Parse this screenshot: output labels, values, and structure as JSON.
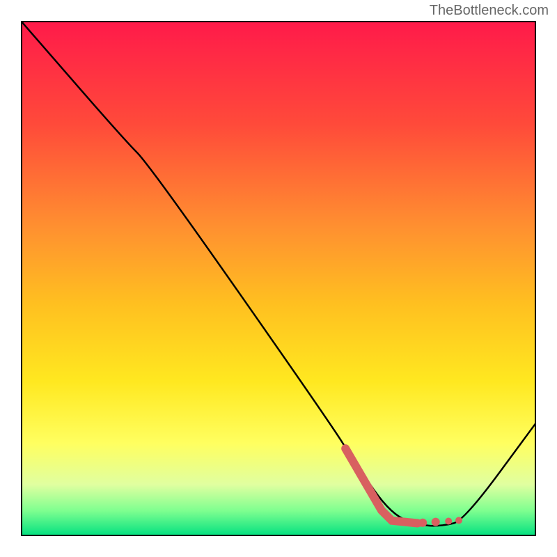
{
  "watermark": "TheBottleneck.com",
  "chart_data": {
    "type": "line",
    "title": "",
    "xlabel": "",
    "ylabel": "",
    "xlim": [
      0,
      100
    ],
    "ylim": [
      0,
      100
    ],
    "background_gradient": {
      "stops": [
        {
          "offset": 0,
          "color": "#ff1a4a"
        },
        {
          "offset": 20,
          "color": "#ff4a3a"
        },
        {
          "offset": 40,
          "color": "#ff9030"
        },
        {
          "offset": 55,
          "color": "#ffc020"
        },
        {
          "offset": 70,
          "color": "#ffe820"
        },
        {
          "offset": 82,
          "color": "#ffff60"
        },
        {
          "offset": 90,
          "color": "#e0ffa0"
        },
        {
          "offset": 95,
          "color": "#80ff90"
        },
        {
          "offset": 100,
          "color": "#00e080"
        }
      ]
    },
    "series": [
      {
        "name": "curve",
        "style": "solid-thin-black",
        "points": [
          {
            "x": 0,
            "y": 100
          },
          {
            "x": 20,
            "y": 77
          },
          {
            "x": 25,
            "y": 72
          },
          {
            "x": 60,
            "y": 22
          },
          {
            "x": 65,
            "y": 14
          },
          {
            "x": 72,
            "y": 4
          },
          {
            "x": 78,
            "y": 2
          },
          {
            "x": 82,
            "y": 2
          },
          {
            "x": 86,
            "y": 3
          },
          {
            "x": 100,
            "y": 22
          }
        ]
      },
      {
        "name": "highlight",
        "style": "thick-red-dashed",
        "color": "#d86060",
        "points": [
          {
            "x": 63,
            "y": 17
          },
          {
            "x": 70,
            "y": 5
          },
          {
            "x": 72,
            "y": 3
          },
          {
            "x": 77,
            "y": 2.5
          },
          {
            "x": 82,
            "y": 2.5
          },
          {
            "x": 85,
            "y": 3
          }
        ]
      }
    ]
  }
}
